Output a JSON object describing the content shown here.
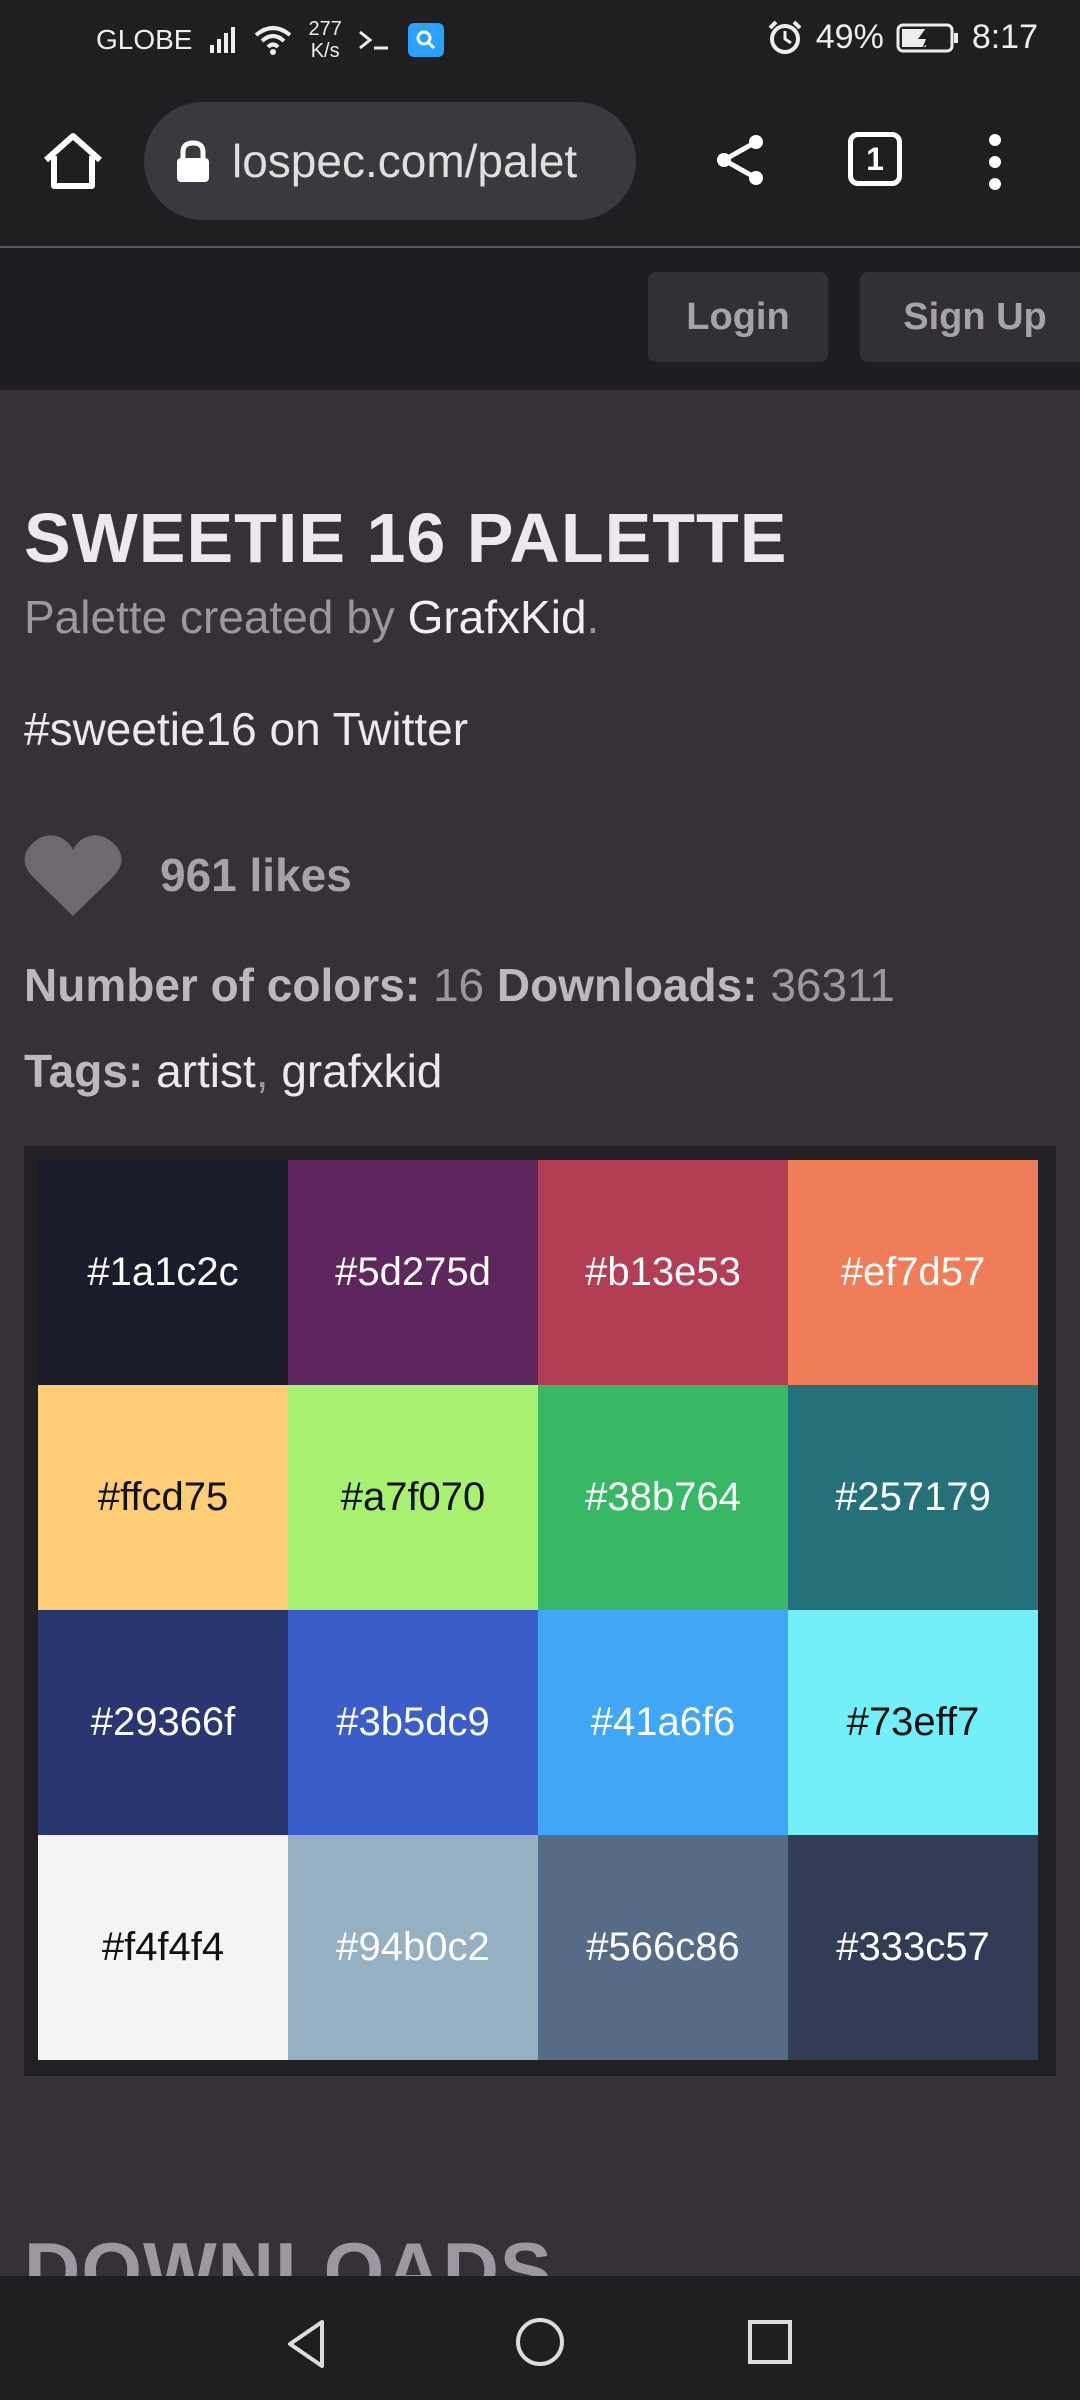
{
  "status_bar": {
    "carrier": "GLOBE",
    "speed_value": "277",
    "speed_unit": "K/s",
    "battery": "49%",
    "time": "8:17"
  },
  "browser": {
    "url": "lospec.com/palet",
    "tab_count": "1"
  },
  "header": {
    "login_label": "Login",
    "signup_label": "Sign Up"
  },
  "palette": {
    "title": "SWEETIE 16 PALETTE",
    "created_by_prefix": "Palette created by ",
    "author": "GrafxKid",
    "created_by_suffix": ".",
    "twitter_text": "#sweetie16 on Twitter",
    "likes_text": "961 likes",
    "num_colors_label": "Number of colors:",
    "num_colors_value": "16",
    "downloads_label": "Downloads:",
    "downloads_value": "36311",
    "tags_label": "Tags:",
    "tags": [
      "artist",
      "grafxkid"
    ],
    "colors": [
      {
        "hex": "#1a1c2c",
        "text_color": "#ffffff"
      },
      {
        "hex": "#5d275d",
        "text_color": "#ffffff"
      },
      {
        "hex": "#b13e53",
        "text_color": "#ffffff"
      },
      {
        "hex": "#ef7d57",
        "text_color": "#ffffff"
      },
      {
        "hex": "#ffcd75",
        "text_color": "#111111"
      },
      {
        "hex": "#a7f070",
        "text_color": "#111111"
      },
      {
        "hex": "#38b764",
        "text_color": "#ffffff"
      },
      {
        "hex": "#257179",
        "text_color": "#ffffff"
      },
      {
        "hex": "#29366f",
        "text_color": "#ffffff"
      },
      {
        "hex": "#3b5dc9",
        "text_color": "#ffffff"
      },
      {
        "hex": "#41a6f6",
        "text_color": "#ffffff"
      },
      {
        "hex": "#73eff7",
        "text_color": "#111111"
      },
      {
        "hex": "#f4f4f4",
        "text_color": "#111111"
      },
      {
        "hex": "#94b0c2",
        "text_color": "#ffffff"
      },
      {
        "hex": "#566c86",
        "text_color": "#ffffff"
      },
      {
        "hex": "#333c57",
        "text_color": "#ffffff"
      }
    ]
  },
  "downloads_heading": "DOWNLOADS"
}
